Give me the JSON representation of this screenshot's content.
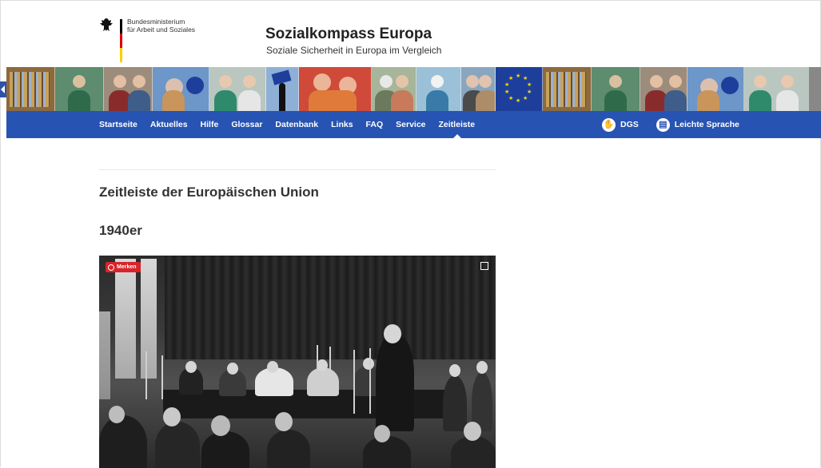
{
  "header": {
    "ministry_line1": "Bundesministerium",
    "ministry_line2": "für Arbeit und Soziales",
    "site_title": "Sozialkompass Europa",
    "site_subtitle": "Soziale Sicherheit in Europa im Vergleich"
  },
  "nav": {
    "items": [
      {
        "label": "Startseite"
      },
      {
        "label": "Aktuelles"
      },
      {
        "label": "Hilfe"
      },
      {
        "label": "Glossar"
      },
      {
        "label": "Datenbank"
      },
      {
        "label": "Links"
      },
      {
        "label": "FAQ"
      },
      {
        "label": "Service"
      },
      {
        "label": "Zeitleiste",
        "active": true
      }
    ],
    "dgs_label": "DGS",
    "leichte_sprache_label": "Leichte Sprache"
  },
  "content": {
    "page_title": "Zeitleiste der Europäischen Union",
    "decade_heading": "1940er",
    "merken_label": "Merken"
  },
  "colors": {
    "nav_blue": "#2753b3",
    "eu_blue": "#1d3f9b",
    "merken_red": "#d8232a"
  }
}
